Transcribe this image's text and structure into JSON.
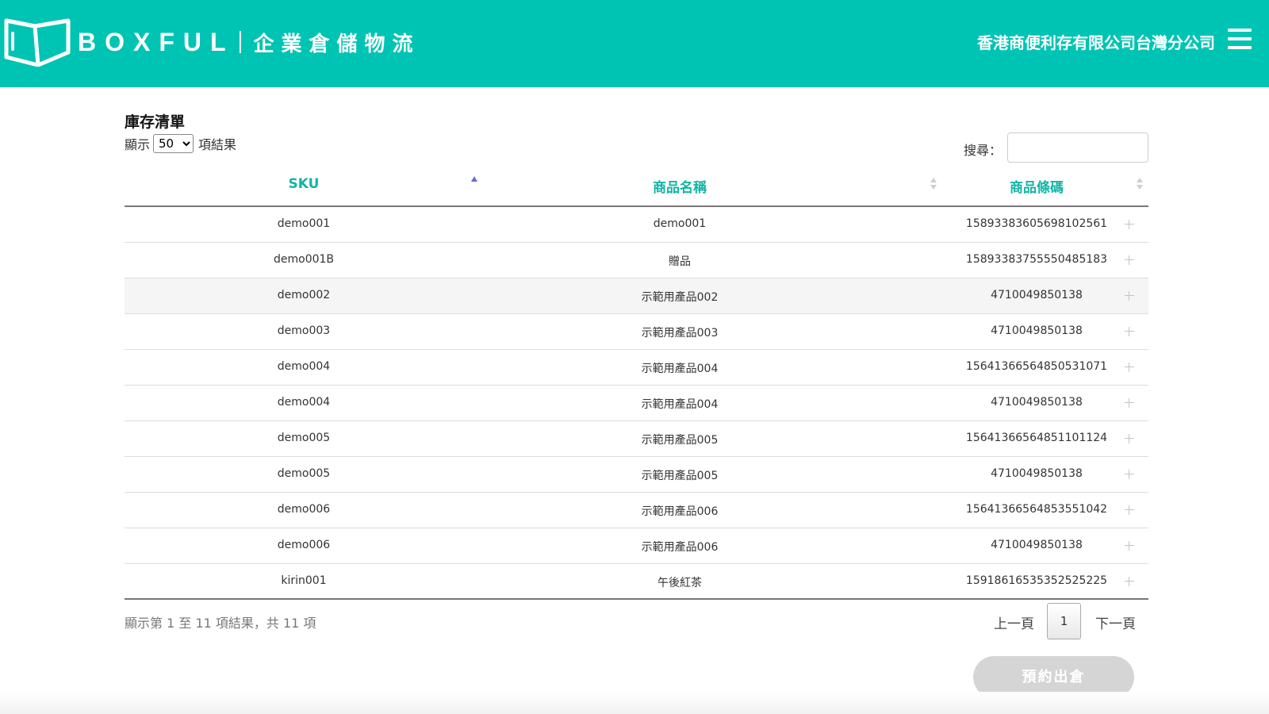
{
  "header": {
    "brand": "BOXFUL",
    "subtitle": "企業倉儲物流",
    "company": "香港商便利存有限公司台灣分公司",
    "icons": {
      "logo": "box-logo",
      "menu": "hamburger-menu-icon"
    },
    "colors": {
      "bar": "#00c4b3",
      "accent_text": "#11b5a6"
    }
  },
  "page": {
    "title": "庫存清單",
    "length": {
      "prefix": "顯示",
      "value": "50",
      "suffix": "項結果",
      "options": [
        "50"
      ]
    },
    "search_label": "搜尋：",
    "search_value": ""
  },
  "table": {
    "columns": [
      "SKU",
      "商品名稱",
      "商品條碼"
    ],
    "rows": [
      {
        "sku": "demo001",
        "name": "demo001",
        "barcode": "15893383605698102561"
      },
      {
        "sku": "demo001B",
        "name": "贈品",
        "barcode": "15893383755550485183"
      },
      {
        "sku": "demo002",
        "name": "示範用產品002",
        "barcode": "4710049850138"
      },
      {
        "sku": "demo003",
        "name": "示範用產品003",
        "barcode": "4710049850138"
      },
      {
        "sku": "demo004",
        "name": "示範用產品004",
        "barcode": "15641366564850531071"
      },
      {
        "sku": "demo004",
        "name": "示範用產品004",
        "barcode": "4710049850138"
      },
      {
        "sku": "demo005",
        "name": "示範用產品005",
        "barcode": "15641366564851101124"
      },
      {
        "sku": "demo005",
        "name": "示範用產品005",
        "barcode": "4710049850138"
      },
      {
        "sku": "demo006",
        "name": "示範用產品006",
        "barcode": "15641366564853551042"
      },
      {
        "sku": "demo006",
        "name": "示範用產品006",
        "barcode": "4710049850138"
      },
      {
        "sku": "kirin001",
        "name": "午後紅茶",
        "barcode": "15918616535352525225"
      }
    ]
  },
  "footer": {
    "info": "顯示第 1 至 11 項結果，共 11 項",
    "prev": "上一頁",
    "page": "1",
    "next": "下一頁",
    "book_button": "預約出倉"
  }
}
